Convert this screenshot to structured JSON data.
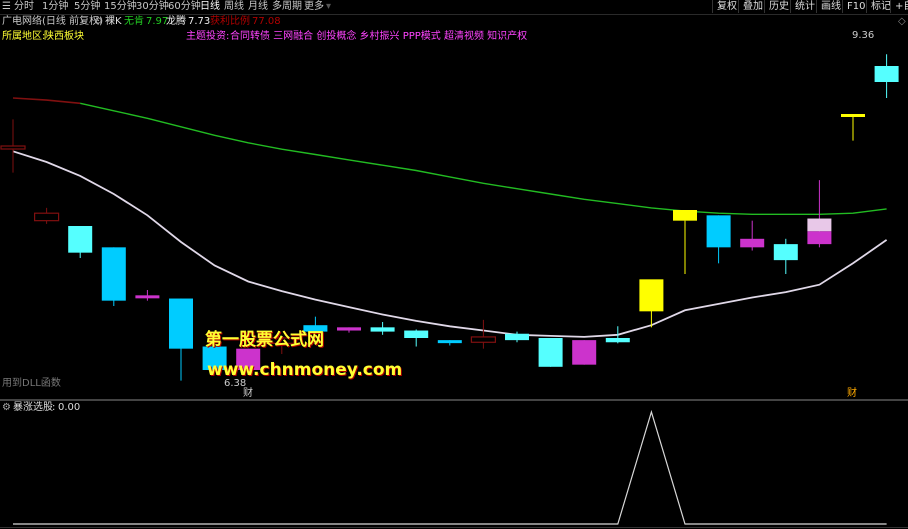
{
  "toolbar": {
    "tabs": [
      "分时",
      "1分钟",
      "5分钟",
      "15分钟",
      "30分钟",
      "60分钟",
      "日线",
      "周线",
      "月线",
      "多周期",
      "更多"
    ],
    "active_tab": "日线",
    "right_buttons": [
      "复权",
      "叠加",
      "历史",
      "统计",
      "画线",
      "F10",
      "标记",
      "+自"
    ],
    "menu_icon": "menu-icon"
  },
  "header": {
    "stock_name": "广电网络(日线 前复权)",
    "indicator_name": "裸K",
    "label_a": "无肯",
    "value_a": "7.97",
    "label_b": "龙腾",
    "value_b": "7.73",
    "label_c": "获利比例",
    "value_c": "77.08"
  },
  "info": {
    "region_label": "所属地区:",
    "region_value": "陕西板块",
    "theme_label": "主题投资:",
    "theme_value": "合同转债 三网融合 创投概念 乡村振兴 PPP模式 超清视频 知识产权"
  },
  "price_labels": {
    "high": "9.36",
    "low": "6.38"
  },
  "markers": {
    "fin_left": "财",
    "fin_right": "财"
  },
  "bottom_left_text": "用到DLL函数",
  "sub_panel": {
    "title": "暴涨选股",
    "value": "0.00"
  },
  "watermark": {
    "line1": "第一股票公式网",
    "line2": "www.chnmoney.com"
  },
  "colors": {
    "up_cyan": "#55ffff",
    "down_cyan": "#00ccff",
    "magenta": "#cc33cc",
    "yellow": "#ffff00",
    "dark_red": "#801010",
    "ma_green": "#22bb22",
    "ma_white": "#e0d8e8",
    "pink_fill": "#e8c8e8",
    "blue_fill": "#1a9fd8"
  },
  "chart_data": {
    "type": "candlestick",
    "candles": [
      {
        "o": 8.5,
        "h": 8.75,
        "l": 8.25,
        "c": 8.5,
        "color": "dark_red",
        "style": "hollow"
      },
      {
        "o": 7.87,
        "h": 7.92,
        "l": 7.77,
        "c": 7.8,
        "color": "dark_red",
        "style": "hollow"
      },
      {
        "o": 7.75,
        "h": 7.75,
        "l": 7.45,
        "c": 7.5,
        "color": "up_cyan",
        "style": "filled"
      },
      {
        "o": 7.55,
        "h": 7.55,
        "l": 7.0,
        "c": 7.05,
        "color": "down_cyan",
        "style": "filled"
      },
      {
        "o": 7.1,
        "h": 7.15,
        "l": 7.05,
        "c": 7.09,
        "color": "magenta",
        "style": "filled"
      },
      {
        "o": 7.07,
        "h": 7.07,
        "l": 6.3,
        "c": 6.6,
        "color": "down_cyan",
        "style": "filled"
      },
      {
        "o": 6.62,
        "h": 6.62,
        "l": 6.4,
        "c": 6.4,
        "color": "down_cyan",
        "style": "filled"
      },
      {
        "o": 6.6,
        "h": 6.6,
        "l": 6.4,
        "c": 6.4,
        "color": "magenta",
        "style": "filled"
      },
      {
        "o": 6.7,
        "h": 6.7,
        "l": 6.55,
        "c": 6.65,
        "color": "dark_red",
        "style": "hollow"
      },
      {
        "o": 6.82,
        "h": 6.9,
        "l": 6.75,
        "c": 6.76,
        "color": "down_cyan",
        "style": "filled"
      },
      {
        "o": 6.8,
        "h": 6.8,
        "l": 6.75,
        "c": 6.77,
        "color": "magenta",
        "style": "filled"
      },
      {
        "o": 6.8,
        "h": 6.85,
        "l": 6.73,
        "c": 6.76,
        "color": "up_cyan",
        "style": "filled"
      },
      {
        "o": 6.77,
        "h": 6.78,
        "l": 6.62,
        "c": 6.7,
        "color": "up_cyan",
        "style": "filled"
      },
      {
        "o": 6.68,
        "h": 6.68,
        "l": 6.63,
        "c": 6.67,
        "color": "down_cyan",
        "style": "filled"
      },
      {
        "o": 6.71,
        "h": 6.87,
        "l": 6.6,
        "c": 6.66,
        "color": "dark_red",
        "style": "hollow"
      },
      {
        "o": 6.74,
        "h": 6.76,
        "l": 6.66,
        "c": 6.68,
        "color": "up_cyan",
        "style": "filled"
      },
      {
        "o": 6.7,
        "h": 6.7,
        "l": 6.43,
        "c": 6.43,
        "color": "up_cyan",
        "style": "filled"
      },
      {
        "o": 6.68,
        "h": 6.68,
        "l": 6.45,
        "c": 6.45,
        "color": "magenta",
        "style": "filled"
      },
      {
        "o": 6.7,
        "h": 6.81,
        "l": 6.65,
        "c": 6.66,
        "color": "up_cyan",
        "style": "filled"
      },
      {
        "o": 6.95,
        "h": 7.1,
        "l": 6.8,
        "c": 7.25,
        "color": "yellow",
        "style": "filled"
      },
      {
        "o": 7.8,
        "h": 7.8,
        "l": 7.3,
        "c": 7.9,
        "color": "yellow",
        "style": "filled"
      },
      {
        "o": 7.85,
        "h": 7.85,
        "l": 7.4,
        "c": 7.55,
        "color": "down_cyan",
        "style": "filled"
      },
      {
        "o": 7.63,
        "h": 7.8,
        "l": 7.52,
        "c": 7.55,
        "color": "magenta",
        "style": "filled"
      },
      {
        "o": 7.58,
        "h": 7.63,
        "l": 7.3,
        "c": 7.43,
        "color": "up_cyan",
        "style": "filled"
      },
      {
        "o": 7.82,
        "h": 8.18,
        "l": 7.55,
        "c": 7.58,
        "color": "magenta",
        "style": "split"
      },
      {
        "o": 8.8,
        "h": 8.8,
        "l": 8.55,
        "c": 8.78,
        "color": "yellow",
        "style": "filled"
      },
      {
        "o": 9.25,
        "h": 9.36,
        "l": 8.95,
        "c": 9.1,
        "color": "up_cyan",
        "style": "filled"
      }
    ],
    "ma_green": [
      [
        0,
        8.95
      ],
      [
        1,
        8.93
      ],
      [
        2,
        8.9
      ],
      [
        3,
        8.83
      ],
      [
        4,
        8.76
      ],
      [
        5,
        8.68
      ],
      [
        6,
        8.6
      ],
      [
        7,
        8.53
      ],
      [
        8,
        8.47
      ],
      [
        9,
        8.42
      ],
      [
        10,
        8.37
      ],
      [
        11,
        8.32
      ],
      [
        12,
        8.27
      ],
      [
        13,
        8.21
      ],
      [
        14,
        8.15
      ],
      [
        15,
        8.1
      ],
      [
        16,
        8.05
      ],
      [
        17,
        8.0
      ],
      [
        18,
        7.96
      ],
      [
        19,
        7.92
      ],
      [
        20,
        7.89
      ],
      [
        21,
        7.87
      ],
      [
        22,
        7.86
      ],
      [
        23,
        7.86
      ],
      [
        24,
        7.86
      ],
      [
        25,
        7.87
      ],
      [
        26,
        7.91
      ]
    ],
    "ma_white": [
      [
        0,
        8.45
      ],
      [
        1,
        8.35
      ],
      [
        2,
        8.22
      ],
      [
        3,
        8.05
      ],
      [
        4,
        7.85
      ],
      [
        5,
        7.6
      ],
      [
        6,
        7.38
      ],
      [
        7,
        7.23
      ],
      [
        8,
        7.14
      ],
      [
        9,
        7.06
      ],
      [
        10,
        6.99
      ],
      [
        11,
        6.92
      ],
      [
        12,
        6.86
      ],
      [
        13,
        6.81
      ],
      [
        14,
        6.77
      ],
      [
        15,
        6.73
      ],
      [
        16,
        6.72
      ],
      [
        17,
        6.71
      ],
      [
        18,
        6.73
      ],
      [
        19,
        6.82
      ],
      [
        20,
        6.96
      ],
      [
        21,
        7.02
      ],
      [
        22,
        7.08
      ],
      [
        23,
        7.13
      ],
      [
        24,
        7.2
      ],
      [
        25,
        7.4
      ],
      [
        26,
        7.62
      ]
    ],
    "ylim": [
      6.25,
      9.55
    ],
    "sub_series": [
      0,
      0,
      0,
      0,
      0,
      0,
      0,
      0,
      0,
      0,
      0,
      0,
      0,
      0,
      0,
      0,
      0,
      0,
      0,
      1,
      0,
      0,
      0,
      0,
      0,
      0,
      0
    ]
  }
}
